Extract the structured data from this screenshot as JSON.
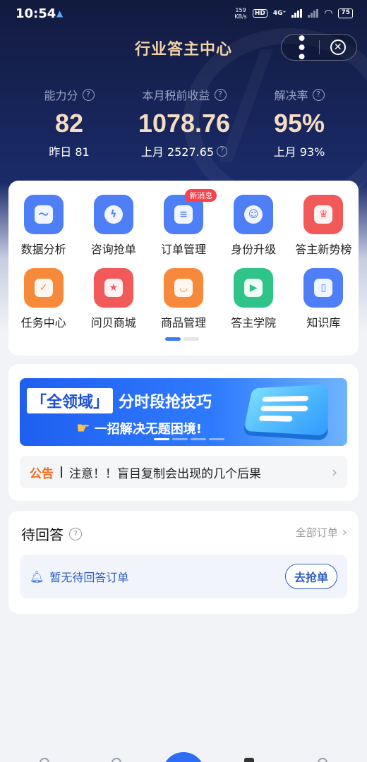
{
  "status_bar": {
    "time": "10:54",
    "net_speed_value": "159",
    "net_speed_unit": "KB/s",
    "hd": "HD",
    "network": "4G⁺",
    "battery": "75"
  },
  "header": {
    "title": "行业答主中心",
    "more_icon": "more-dots-icon",
    "close_icon": "close-circle-icon"
  },
  "stats": [
    {
      "label": "能力分",
      "value": "82",
      "sub": "昨日 81",
      "has_sub_help": false
    },
    {
      "label": "本月税前收益",
      "value": "1078.76",
      "sub": "上月 2527.65",
      "has_sub_help": true
    },
    {
      "label": "解决率",
      "value": "95%",
      "sub": "上月 93%",
      "has_sub_help": false
    }
  ],
  "menu": {
    "rows": [
      [
        {
          "label": "数据分析",
          "icon": "chart-icon",
          "color": "#4f7ff7"
        },
        {
          "label": "咨询抢单",
          "icon": "lightning-icon",
          "color": "#4f7ff7"
        },
        {
          "label": "订单管理",
          "icon": "document-icon",
          "color": "#4f7ff7",
          "badge": "新消息"
        },
        {
          "label": "身份升级",
          "icon": "user-icon",
          "color": "#4f7ff7"
        },
        {
          "label": "答主新势榜",
          "icon": "trophy-icon",
          "color": "#f25a5a"
        }
      ],
      [
        {
          "label": "任务中心",
          "icon": "task-check-icon",
          "color": "#f78a3a"
        },
        {
          "label": "问贝商城",
          "icon": "gift-icon",
          "color": "#f25a5a"
        },
        {
          "label": "商品管理",
          "icon": "shopping-bag-icon",
          "color": "#f78a3a"
        },
        {
          "label": "答主学院",
          "icon": "video-play-icon",
          "color": "#2fc48a"
        },
        {
          "label": "知识库",
          "icon": "book-icon",
          "color": "#4f7ff7"
        }
      ]
    ],
    "page_indicator": {
      "active": 1,
      "total": 2
    }
  },
  "banner": {
    "highlight": "「全领域」",
    "headline_rest": "分时段抢技巧",
    "subline": "一招解决无题困境!",
    "hand_icon": "pointing-hand-icon",
    "slides": 4,
    "active_slide": 1
  },
  "notice": {
    "tag": "公告",
    "text": "注意！！盲目复制会出现的几个后果"
  },
  "pending": {
    "title": "待回答",
    "all_orders_label": "全部订单",
    "empty_text": "暂无待回答订单",
    "grab_button": "去抢单"
  }
}
